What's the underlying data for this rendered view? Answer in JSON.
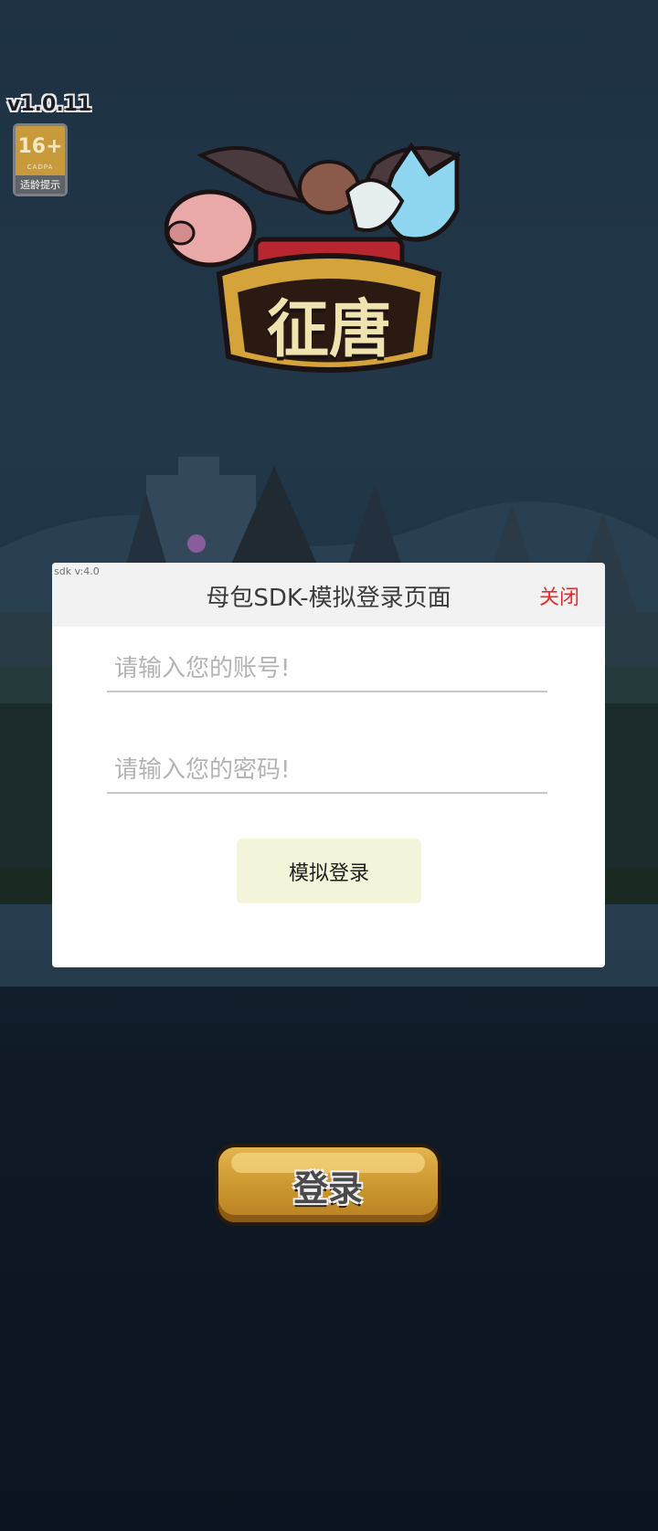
{
  "version": "v1.0.11",
  "age_badge": {
    "rating": "16+",
    "org": "CADPA",
    "tip": "适龄提示"
  },
  "logo": {
    "title": "征唐"
  },
  "dialog": {
    "sdk_version": "sdk v:4.0",
    "title": "母包SDK-模拟登录页面",
    "close_label": "关闭",
    "account_placeholder": "请输入您的账号!",
    "password_placeholder": "请输入您的密码!",
    "submit_label": "模拟登录"
  },
  "game": {
    "login_label": "登录"
  }
}
